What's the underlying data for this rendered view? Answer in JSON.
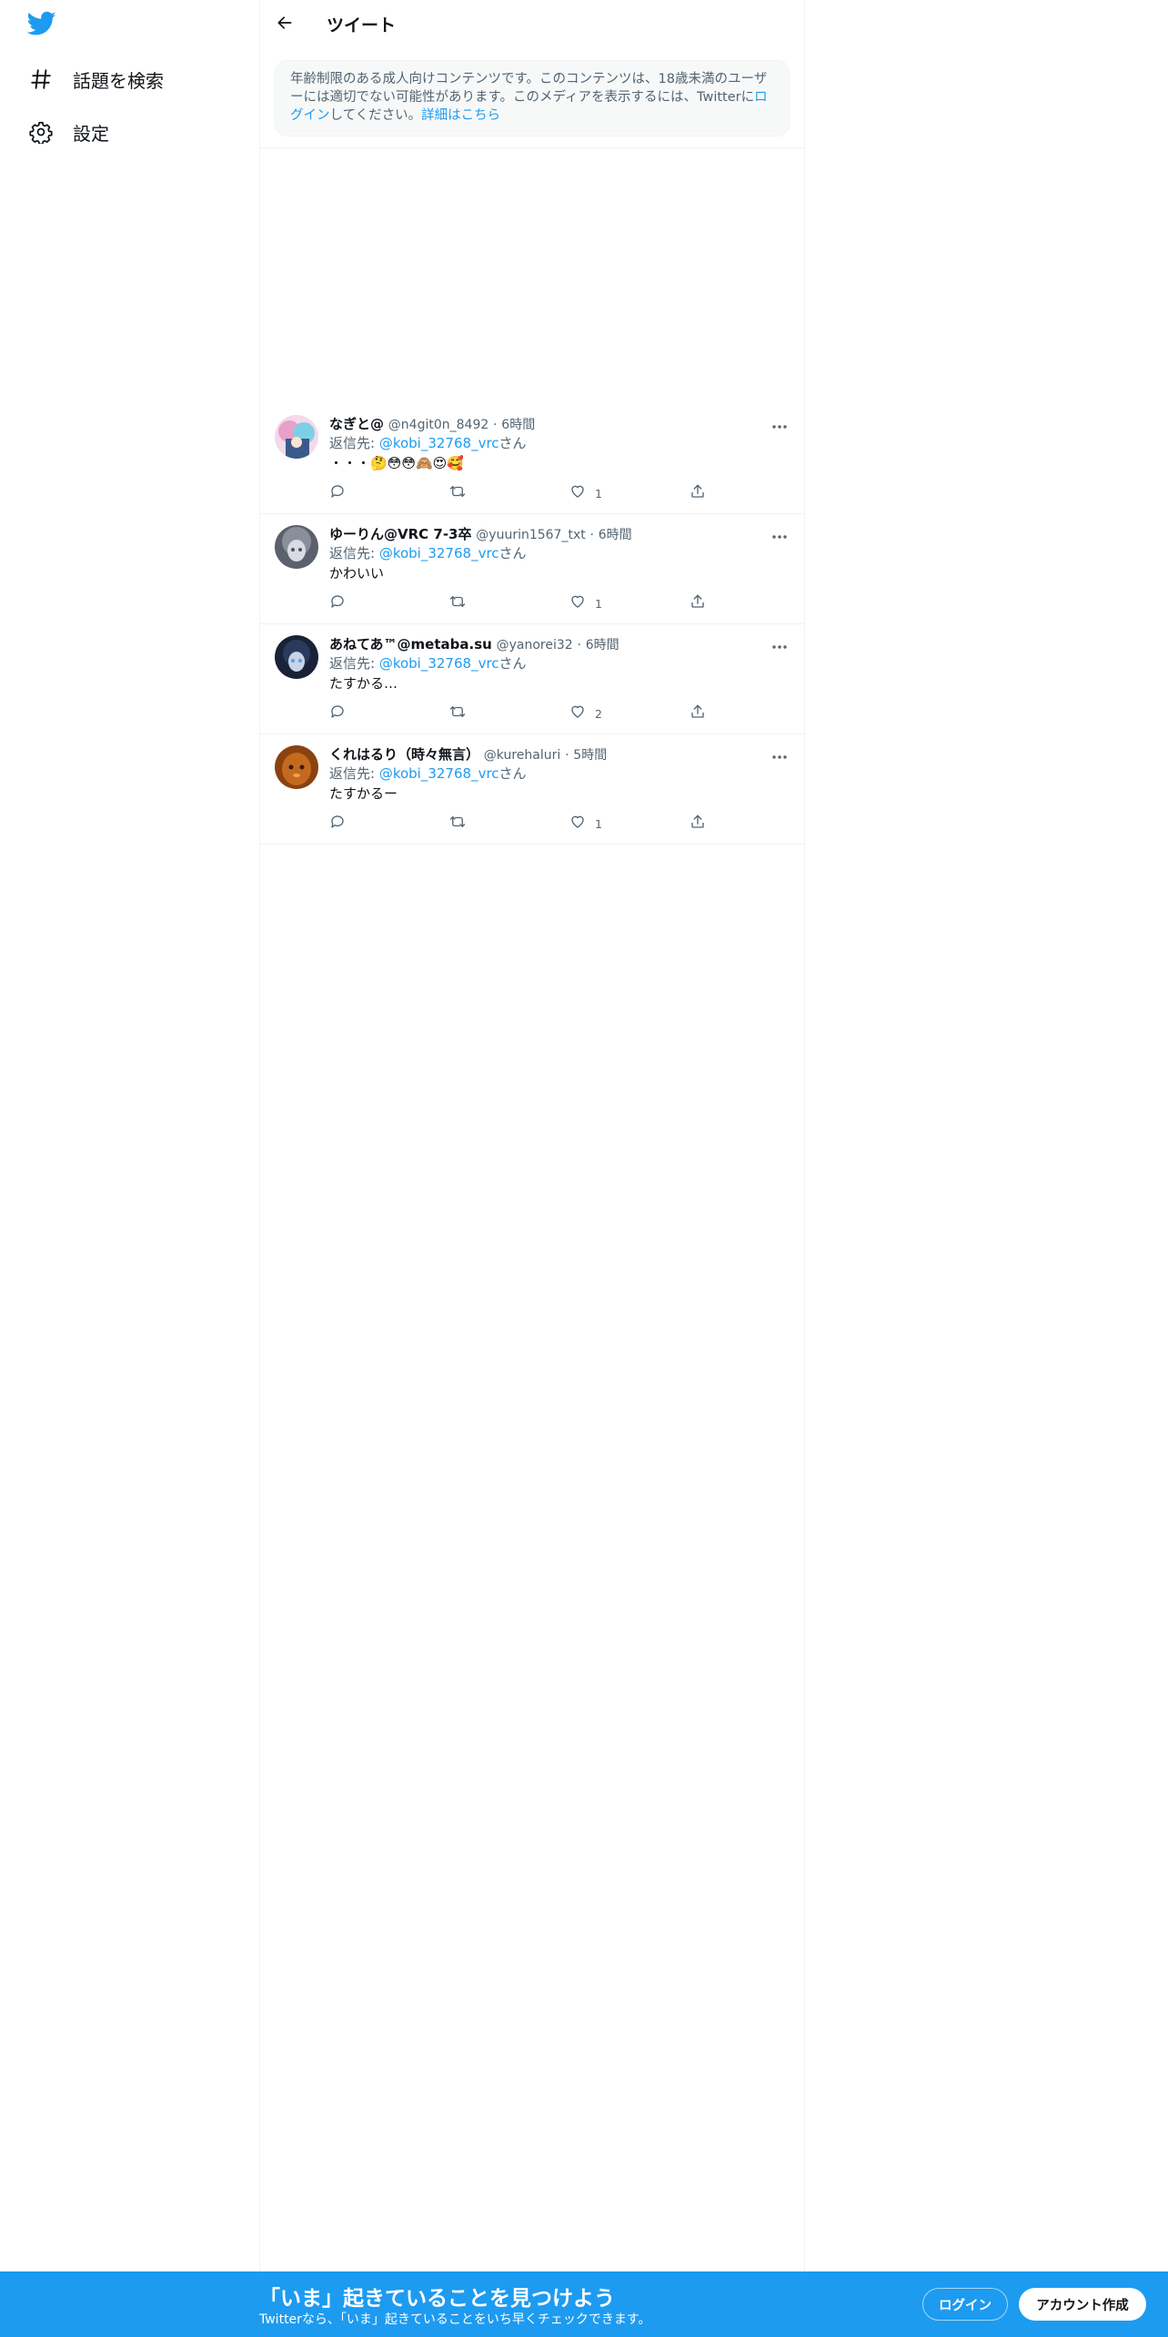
{
  "colors": {
    "accent": "#1d9bf0",
    "text_primary": "#0f1419",
    "text_secondary": "#536471",
    "border": "#eff3f4",
    "notice_bg": "#f7f9f9"
  },
  "sidebar": {
    "logo_icon": "twitter-bird-icon",
    "items": [
      {
        "icon": "hashtag-icon",
        "label": "話題を検索"
      },
      {
        "icon": "gear-icon",
        "label": "設定"
      }
    ]
  },
  "header": {
    "back_icon": "arrow-left-icon",
    "title": "ツイート"
  },
  "notice": {
    "text_before": "年齢制限のある成人向けコンテンツです。このコンテンツは、18歳未満のユーザーには適切でない可能性があります。このメディアを表示するには、Twitterに",
    "login_link": "ログイン",
    "text_after": "してください。",
    "learn_more": "詳細はこちら"
  },
  "replies": [
    {
      "name": "なぎと@",
      "handle": "@n4git0n_8492",
      "time": "6時間",
      "reply_prefix": "返信先: ",
      "reply_mention": "@kobi_32768_vrc",
      "reply_suffix": "さん",
      "text": "・・・🤔😳😳🙈😍🥰",
      "likes": "1",
      "avatar_colors": [
        "#e8a0c8",
        "#7ecfe6",
        "#3a5a8c"
      ]
    },
    {
      "name": "ゆーりん@VRC 7-3卒",
      "handle": "@yuurin1567_txt",
      "time": "6時間",
      "reply_prefix": "返信先: ",
      "reply_mention": "@kobi_32768_vrc",
      "reply_suffix": "さん",
      "text": "かわいい",
      "likes": "1",
      "avatar_colors": [
        "#8a8f9a",
        "#c9cdd6",
        "#4a505c"
      ]
    },
    {
      "name": "あねてあ™@metaba.su",
      "handle": "@yanorei32",
      "time": "6時間",
      "reply_prefix": "返信先: ",
      "reply_mention": "@kobi_32768_vrc",
      "reply_suffix": "さん",
      "text": "たすかる…",
      "likes": "2",
      "avatar_colors": [
        "#2a3a5c",
        "#6aa0d8",
        "#1a2238"
      ]
    },
    {
      "name": "くれはるり（時々無言）",
      "handle": "@kurehaluri",
      "time": "5時間",
      "reply_prefix": "返信先: ",
      "reply_mention": "@kobi_32768_vrc",
      "reply_suffix": "さん",
      "text": "たすかるー",
      "likes": "1",
      "avatar_colors": [
        "#c46a1e",
        "#8a4210",
        "#f0a050"
      ]
    }
  ],
  "bottom_bar": {
    "title": "「いま」起きていることを見つけよう",
    "subtitle": "Twitterなら、「いま」起きていることをいち早くチェックできます。",
    "login_label": "ログイン",
    "signup_label": "アカウント作成"
  }
}
